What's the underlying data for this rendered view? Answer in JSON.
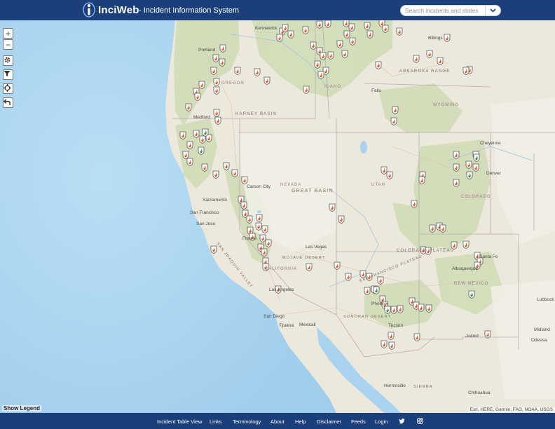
{
  "header": {
    "brand": "InciWeb",
    "tagline": "- Incident Information System",
    "search_placeholder": "Search incidents and states"
  },
  "map": {
    "controls": {
      "zoom_in": "+",
      "zoom_out": "−"
    },
    "legend_label": "Show Legend",
    "attribution": "Esri, HERE, Garmin, FAO, NOAA, USGS",
    "labels": {
      "portland": "Portland",
      "kennewick": "Kennewick",
      "billings": "Billings",
      "oregon": "OREGON",
      "idaho": "IDAHO",
      "harney": "HARNEY BASIN",
      "absaroka": "ABSAROKA RANGE",
      "falls": "Falls",
      "wyoming": "WYOMING",
      "medford": "Medford",
      "cheyenne": "Cheyenne",
      "carson": "Carson City",
      "nevada": "NEVADA",
      "great_basin": "GREAT BASIN",
      "utah": "UTAH",
      "denver": "Denver",
      "colorado": "COLORADO",
      "sacramento": "Sacramento",
      "san_francisco": "San Francisco",
      "san_jose": "San Jose",
      "fresno": "Fresno",
      "sj_valley": "SAN JOAQUIN VALLEY",
      "las_vegas": "Las Vegas",
      "mojave": "MOJAVE DESERT",
      "california": "CALIFORNIA",
      "colorado_plateau": "COLORADO PLATEAU",
      "sf_plateau": "SAN FRANCISCO PLATEAU",
      "albuquerque": "Albuquerque",
      "santa_fe": "Santa Fe",
      "new_mexico": "NEW MEXICO",
      "los_angeles": "Los Angeles",
      "phoenix": "Phoenix",
      "san_diego": "San Diego",
      "tijuana": "Tijuana",
      "mexicali": "Mexicali",
      "sonoran": "SONORAN DESERT",
      "tucson": "Tucson",
      "juarez": "Juárez",
      "lubbock": "Lubbock",
      "midland": "Midland",
      "odessa": "Odessa",
      "hermosillo": "Hermosillo",
      "chihuahua": "Chihuahua",
      "sierra": "SIERRA"
    }
  },
  "footer": {
    "links": [
      "Incident Table View",
      "Links",
      "Terminology",
      "About",
      "Help",
      "Disclaimer",
      "Feeds",
      "Login"
    ]
  },
  "colors": {
    "header_bg": "#1b3f7a",
    "ocean": "#a9d3ee",
    "fire_marker": "#e8541c",
    "prescribed_marker": "#3e8a4b"
  },
  "icons": {
    "wildfire": "flame-shield-icon",
    "prescribed": "green-leaf-shield-icon"
  }
}
